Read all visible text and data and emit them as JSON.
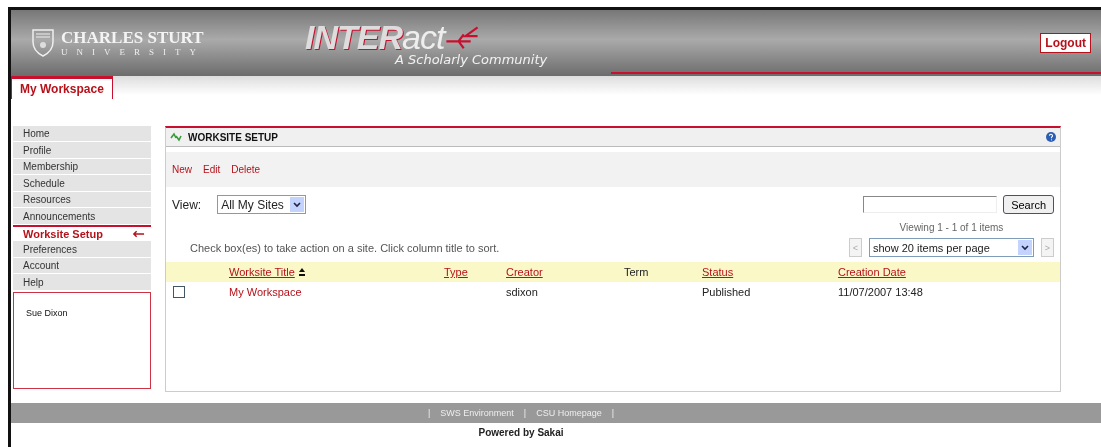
{
  "header": {
    "university": "CHARLES STURT",
    "university_sub": "UNIVERSITY",
    "brand_strong": "INTER",
    "brand_light": "act",
    "tagline": "A Scholarly Community",
    "logout": "Logout"
  },
  "tabs": [
    {
      "label": "My Workspace",
      "selected": true
    }
  ],
  "sidebar": {
    "items": [
      {
        "label": "Home",
        "selected": false
      },
      {
        "label": "Profile",
        "selected": false
      },
      {
        "label": "Membership",
        "selected": false
      },
      {
        "label": "Schedule",
        "selected": false
      },
      {
        "label": "Resources",
        "selected": false
      },
      {
        "label": "Announcements",
        "selected": false
      },
      {
        "label": "Worksite Setup",
        "selected": true
      },
      {
        "label": "Preferences",
        "selected": false
      },
      {
        "label": "Account",
        "selected": false
      },
      {
        "label": "Help",
        "selected": false
      }
    ],
    "user": "Sue Dixon"
  },
  "tool": {
    "title": "WORKSITE SETUP",
    "actions": [
      "New",
      "Edit",
      "Delete"
    ],
    "view_label": "View:",
    "view_value": "All My Sites",
    "search_button": "Search",
    "viewing": "Viewing 1 - 1 of 1 items",
    "page_size": "show 20 items per page",
    "prev": "<",
    "next": ">",
    "instructions": "Check box(es) to take action on a site. Click column title to sort.",
    "table": {
      "columns": [
        {
          "label": "Worksite Title",
          "sortable": true,
          "sorted": true
        },
        {
          "label": "Type",
          "sortable": true,
          "sorted": false
        },
        {
          "label": "Creator",
          "sortable": true,
          "sorted": false
        },
        {
          "label": "Term",
          "sortable": false,
          "sorted": false
        },
        {
          "label": "Status",
          "sortable": true,
          "sorted": false
        },
        {
          "label": "Creation Date",
          "sortable": true,
          "sorted": false
        }
      ],
      "rows": [
        {
          "checked": false,
          "cells": [
            "My Workspace",
            "",
            "sdixon",
            "",
            "Published",
            "11/07/2007 13:48"
          ]
        }
      ]
    }
  },
  "footer": {
    "separator": "|",
    "links": [
      "SWS Environment",
      "CSU Homepage"
    ],
    "powered": "Powered by Sakai"
  }
}
